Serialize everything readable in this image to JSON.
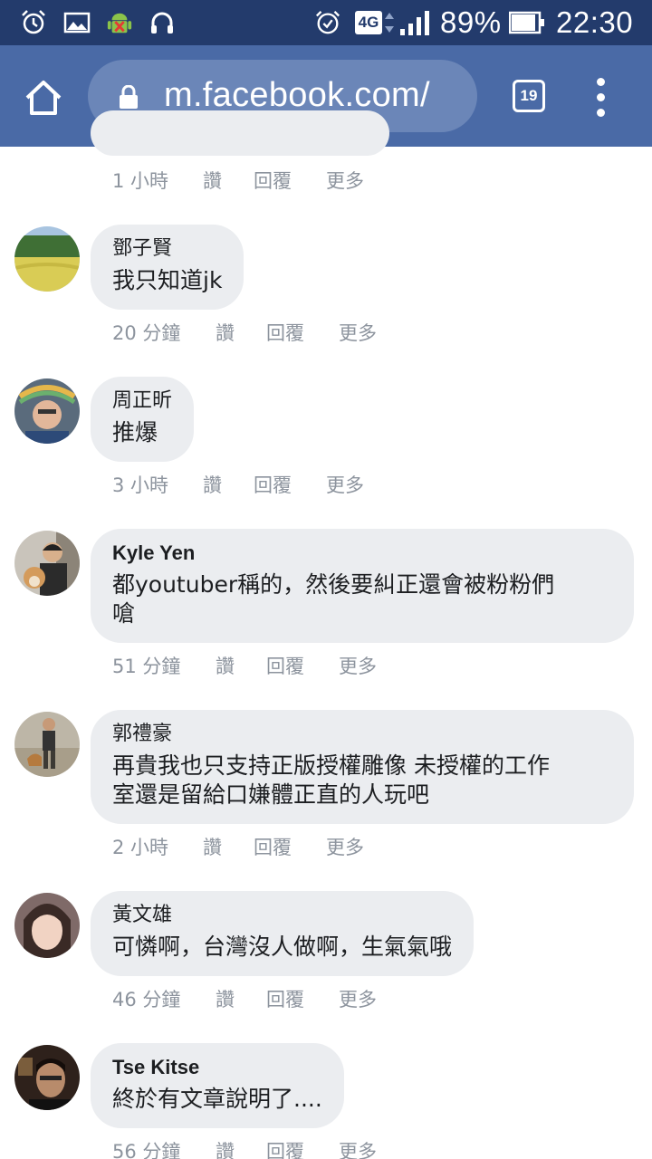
{
  "status_bar": {
    "battery": "89%",
    "time": "22:30",
    "network": "4G"
  },
  "browser": {
    "url": "m.facebook.com/",
    "tab_count": "19",
    "icons": [
      "home-icon",
      "lock-icon",
      "tabs-icon",
      "more-vert-icon"
    ]
  },
  "colors": {
    "status_bar": "#233b6c",
    "toolbar": "#4a6aa6",
    "url_bar": "#6b86b8",
    "bubble": "#ebedf0",
    "meta_text": "#8d949e"
  },
  "top_partial": {
    "time": "1 小時",
    "like": "讚",
    "reply": "回覆",
    "more": "更多"
  },
  "comments": [
    {
      "author": "鄧子賢",
      "lines": [
        "我只知道jk"
      ],
      "time": "20 分鐘",
      "like": "讚",
      "reply": "回覆",
      "more": "更多"
    },
    {
      "author": "周正昕",
      "lines": [
        "推爆"
      ],
      "time": "3 小時",
      "like": "讚",
      "reply": "回覆",
      "more": "更多"
    },
    {
      "author": "Kyle Yen",
      "lines": [
        "都youtuber稱的，然後要糾正還會被粉粉們",
        "嗆"
      ],
      "time": "51 分鐘",
      "like": "讚",
      "reply": "回覆",
      "more": "更多"
    },
    {
      "author": "郭禮豪",
      "lines": [
        "再貴我也只支持正版授權雕像 未授權的工作",
        "室還是留給口嫌體正直的人玩吧"
      ],
      "time": "2 小時",
      "like": "讚",
      "reply": "回覆",
      "more": "更多"
    },
    {
      "author": "黃文雄",
      "lines": [
        "可憐啊，台灣沒人做啊，生氣氣哦"
      ],
      "time": "46 分鐘",
      "like": "讚",
      "reply": "回覆",
      "more": "更多"
    },
    {
      "author": "Tse Kitse",
      "lines": [
        "終於有文章說明了...."
      ],
      "time": "56 分鐘",
      "like": "讚",
      "reply": "回覆",
      "more": "更多"
    }
  ]
}
